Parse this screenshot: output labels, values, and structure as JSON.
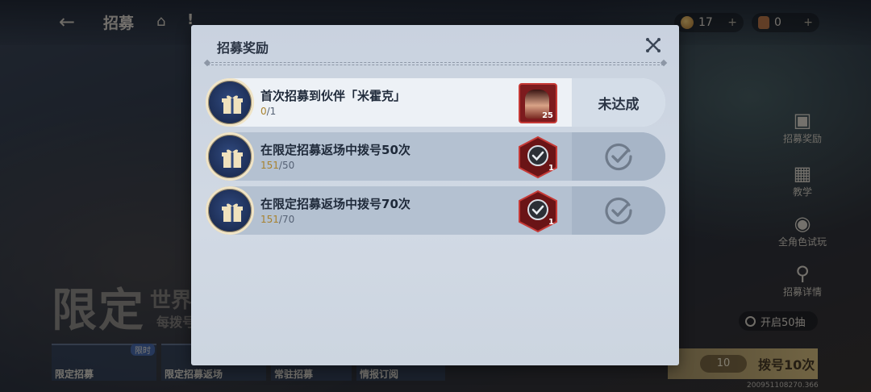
{
  "background": {
    "page_title": "招募",
    "currencies": [
      {
        "value": "17",
        "plus": "+"
      },
      {
        "value": "0",
        "plus": "+"
      }
    ],
    "side_menu": [
      {
        "label": "招募奖励",
        "icon": "gift-icon"
      },
      {
        "label": "教学",
        "icon": "book-icon"
      },
      {
        "label": "全角色试玩",
        "icon": "gamepad-icon"
      },
      {
        "label": "招募详情",
        "icon": "magnifier-icon"
      }
    ],
    "banner_title": "限定",
    "banner_sub": "世界",
    "banner_sub2": "每拨号",
    "open_50_label": "开启50抽",
    "tabs": [
      {
        "label": "限定招募",
        "badge": "限时"
      },
      {
        "label": "限定招募返场"
      },
      {
        "label": "常驻招募"
      },
      {
        "label": "情报订阅"
      }
    ],
    "draw10_cost": "10",
    "draw10_label": "拨号10次",
    "uid": "200951108270.366"
  },
  "modal": {
    "title": "招募奖励",
    "rows": [
      {
        "title": "首次招募到伙伴「米霍克」",
        "progress_current": "0",
        "progress_total": "/1",
        "reward_type": "character-portrait",
        "reward_count": "25",
        "status": "未达成"
      },
      {
        "title": "在限定招募返场中拨号50次",
        "progress_current": "151",
        "progress_total": "/50",
        "reward_type": "claimed-token",
        "reward_count": "1",
        "status": "check-icon"
      },
      {
        "title": "在限定招募返场中拨号70次",
        "progress_current": "151",
        "progress_total": "/70",
        "reward_type": "claimed-token",
        "reward_count": "1",
        "status": "check-icon"
      }
    ]
  },
  "colors": {
    "modal_bg": "#c9d2df",
    "row_active": "#edf1f6",
    "row_done": "#b4c1d1",
    "gift_circle": "#1d2e55",
    "reward_red": "#7d1b1e",
    "progress_gold": "#a8822f"
  }
}
